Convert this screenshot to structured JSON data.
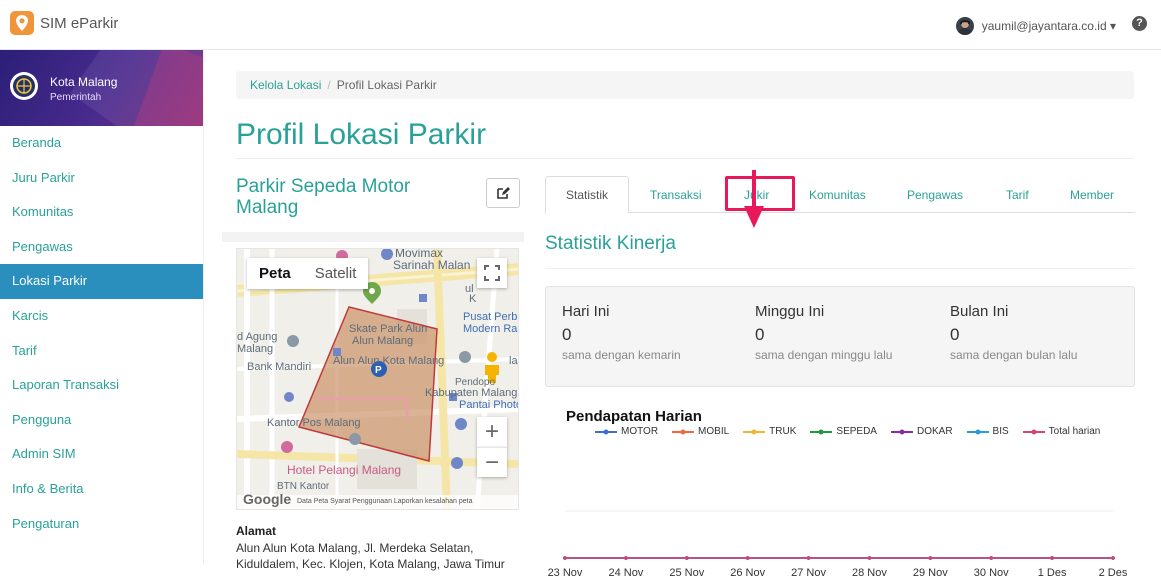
{
  "header": {
    "app_name": "SIM eParkir",
    "user_email": "yaumil@jayantara.co.id ▾",
    "help_glyph": "?"
  },
  "sidebar": {
    "org_name": "Kota Malang",
    "org_role": "Pemerintah",
    "items": [
      {
        "label": "Beranda",
        "active": false
      },
      {
        "label": "Juru Parkir",
        "active": false
      },
      {
        "label": "Komunitas",
        "active": false
      },
      {
        "label": "Pengawas",
        "active": false
      },
      {
        "label": "Lokasi Parkir",
        "active": true
      },
      {
        "label": "Karcis",
        "active": false
      },
      {
        "label": "Tarif",
        "active": false
      },
      {
        "label": "Laporan Transaksi",
        "active": false
      },
      {
        "label": "Pengguna",
        "active": false
      },
      {
        "label": "Admin SIM",
        "active": false
      },
      {
        "label": "Info & Berita",
        "active": false
      },
      {
        "label": "Pengaturan",
        "active": false
      }
    ]
  },
  "breadcrumb": {
    "link": "Kelola Lokasi",
    "separator": "/",
    "current": "Profil Lokasi Parkir"
  },
  "page_title": "Profil Lokasi Parkir",
  "location": {
    "name": "Parkir Sepeda Motor Malang",
    "map": {
      "tab_map": "Peta",
      "tab_satellite": "Satelit",
      "labels": [
        "Movimax",
        "Sarinah Malan",
        "Skate Park Alun",
        "Alun Malang",
        "Pusat Perb",
        "Modern Ra",
        "d Agung",
        "Malang",
        "Alun Alun Kota Malang",
        "Bank Mandiri",
        "Kabupaten Malang",
        "Pantai Photo",
        "Kantor Pos Malang",
        "Hotel Pelangi Malang",
        "BTN Kantor",
        "Pendopo",
        "ul",
        "K",
        "la"
      ],
      "zoom_in": "+",
      "zoom_out": "−",
      "google": "Google",
      "footer": "Data Peta   Syarat Penggunaan   Laporkan kesalahan peta"
    },
    "address_label": "Alamat",
    "address_text": "Alun Alun Kota Malang, Jl. Merdeka Selatan, Kiduldalem, Kec. Klojen, Kota Malang, Jawa Timur"
  },
  "tabs": [
    {
      "label": "Statistik",
      "active": true
    },
    {
      "label": "Transaksi",
      "active": false
    },
    {
      "label": "Jukir",
      "active": false,
      "highlighted": true
    },
    {
      "label": "Komunitas",
      "active": false
    },
    {
      "label": "Pengawas",
      "active": false
    },
    {
      "label": "Tarif",
      "active": false
    },
    {
      "label": "Member",
      "active": false
    }
  ],
  "stats": {
    "title": "Statistik Kinerja",
    "cards": [
      {
        "name": "Hari Ini",
        "value": "0",
        "sub": "sama dengan kemarin"
      },
      {
        "name": "Minggu Ini",
        "value": "0",
        "sub": "sama dengan minggu lalu"
      },
      {
        "name": "Bulan Ini",
        "value": "0",
        "sub": "sama dengan bulan lalu"
      }
    ]
  },
  "colors": {
    "accent": "#2aa198",
    "active_nav": "#2a8fbd",
    "highlight": "#e8195b"
  },
  "chart_data": {
    "type": "line",
    "title": "Pendapatan Harian",
    "x": [
      "23 Nov",
      "24 Nov",
      "25 Nov",
      "26 Nov",
      "27 Nov",
      "28 Nov",
      "29 Nov",
      "30 Nov",
      "1 Des",
      "2 Des"
    ],
    "series": [
      {
        "name": "MOTOR",
        "color": "#3b6fd6",
        "values": [
          0,
          0,
          0,
          0,
          0,
          0,
          0,
          0,
          0,
          0
        ]
      },
      {
        "name": "MOBIL",
        "color": "#f06a3a",
        "values": [
          0,
          0,
          0,
          0,
          0,
          0,
          0,
          0,
          0,
          0
        ]
      },
      {
        "name": "TRUK",
        "color": "#f0b43a",
        "values": [
          0,
          0,
          0,
          0,
          0,
          0,
          0,
          0,
          0,
          0
        ]
      },
      {
        "name": "SEPEDA",
        "color": "#1f9a3a",
        "values": [
          0,
          0,
          0,
          0,
          0,
          0,
          0,
          0,
          0,
          0
        ]
      },
      {
        "name": "DOKAR",
        "color": "#8a2aa8",
        "values": [
          0,
          0,
          0,
          0,
          0,
          0,
          0,
          0,
          0,
          0
        ]
      },
      {
        "name": "BIS",
        "color": "#2a9bd6",
        "values": [
          0,
          0,
          0,
          0,
          0,
          0,
          0,
          0,
          0,
          0
        ]
      },
      {
        "name": "Total harian",
        "color": "#d6427a",
        "values": [
          0,
          0,
          0,
          0,
          0,
          0,
          0,
          0,
          0,
          0
        ]
      }
    ]
  }
}
